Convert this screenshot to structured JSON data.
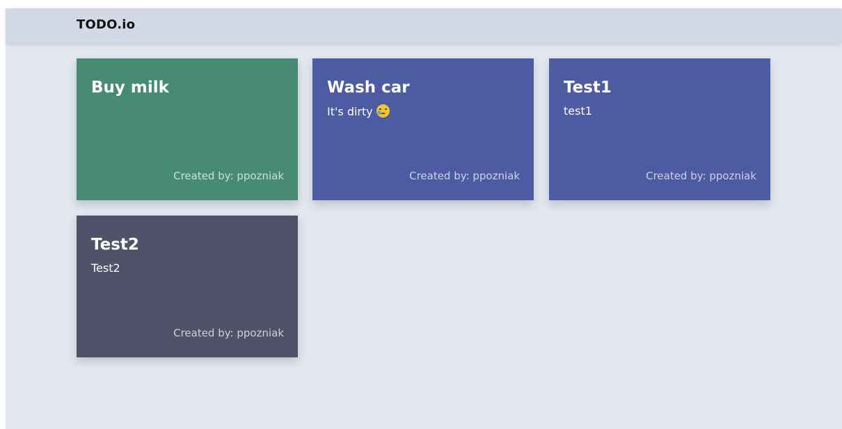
{
  "app": {
    "title": "TODO.io"
  },
  "todos": [
    {
      "title": "Buy milk",
      "description": "",
      "created_by_label": "Created by: ppozniak",
      "color": "#488b74"
    },
    {
      "title": "Wash car",
      "description": "It's dirty",
      "emoji": "sad-but-relieved-face-icon",
      "created_by_label": "Created by: ppozniak",
      "color": "#4d5ca2"
    },
    {
      "title": "Test1",
      "description": "test1",
      "created_by_label": "Created by: ppozniak",
      "color": "#4d5ca2"
    },
    {
      "title": "Test2",
      "description": "Test2",
      "created_by_label": "Created by: ppozniak",
      "color": "#4f5268"
    }
  ],
  "colors": {
    "page_background": "#e2e7ef",
    "header_background": "#d2d8e4"
  }
}
